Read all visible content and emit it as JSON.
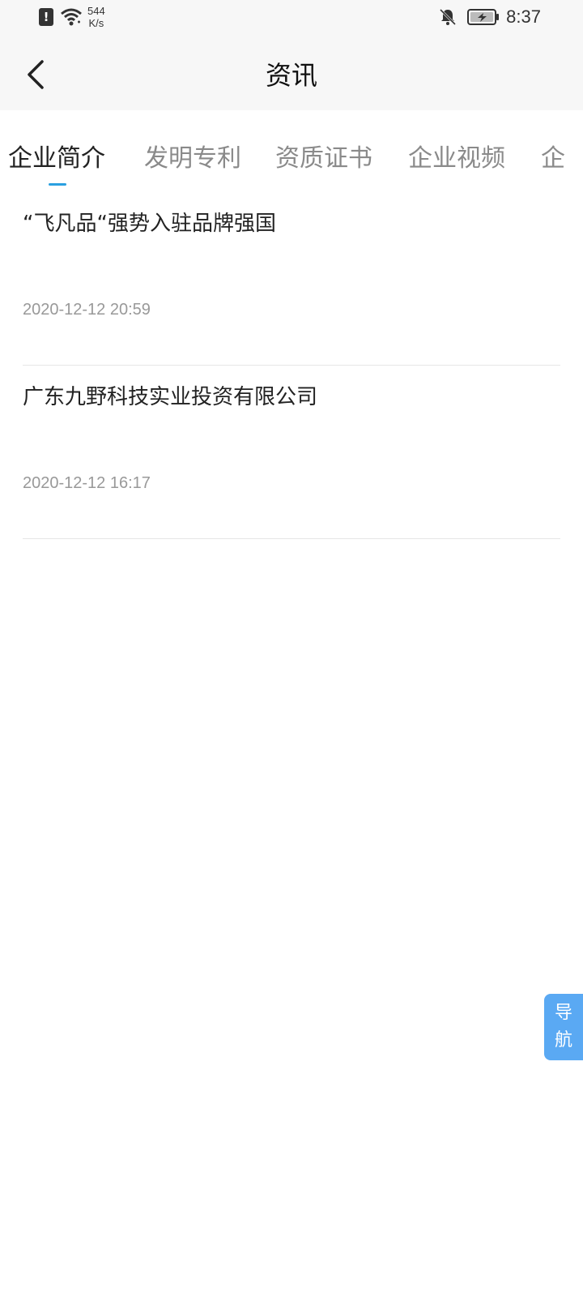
{
  "status_bar": {
    "sim_alert_glyph": "!",
    "net_speed_value": "544",
    "net_speed_unit": "K/s",
    "time": "8:37",
    "icons": [
      "sim-alert-icon",
      "wifi-icon",
      "bell-muted-icon",
      "battery-charging-icon"
    ]
  },
  "nav": {
    "title": "资讯",
    "back_icon": "chevron-left-icon"
  },
  "tabs": {
    "items": [
      {
        "label": "企业简介",
        "active": true
      },
      {
        "label": "发明专利",
        "active": false
      },
      {
        "label": "资质证书",
        "active": false
      },
      {
        "label": "企业视频",
        "active": false
      },
      {
        "label": "企",
        "active": false
      }
    ],
    "indicator_color": "#2aa0e0"
  },
  "news": [
    {
      "title": "“飞凡品“强势入驻品牌强国",
      "date": "2020-12-12 20:59"
    },
    {
      "title": "广东九野科技实业投资有限公司",
      "date": "2020-12-12 16:17"
    }
  ],
  "float_nav": {
    "line1": "导",
    "line2": "航",
    "color": "#5aa9f3"
  }
}
